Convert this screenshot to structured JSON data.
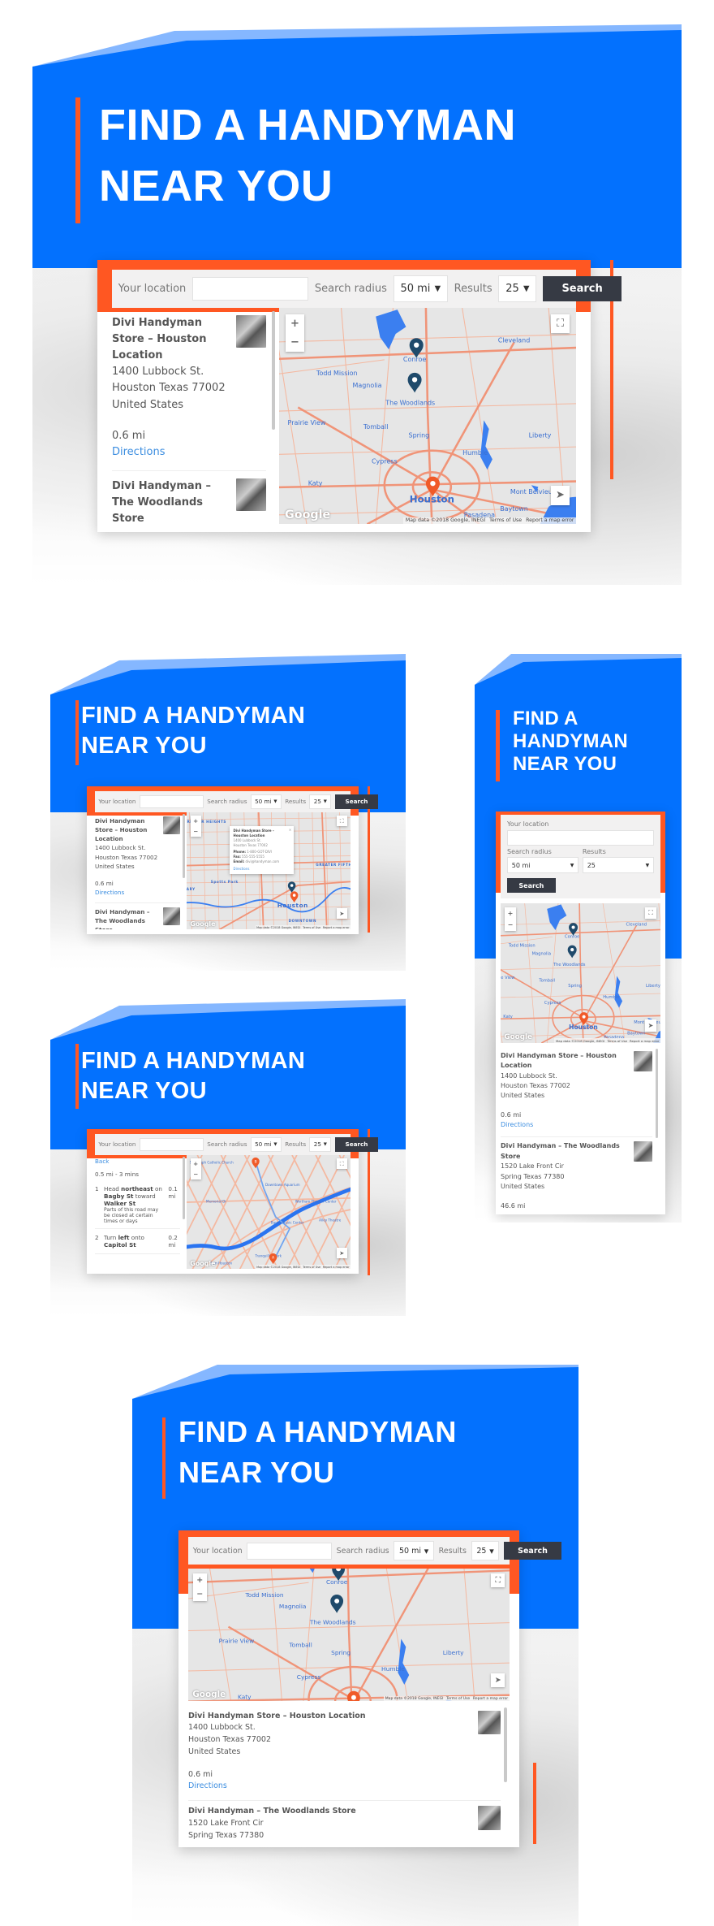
{
  "heading": "Find a Handyman Near You",
  "search_form": {
    "location_label": "Your location",
    "location_value": "",
    "radius_label": "Search radius",
    "radius_value": "50 mi",
    "results_label": "Results",
    "results_value": "25",
    "search_button": "Search"
  },
  "stores": [
    {
      "name": "Divi Handyman Store – Houston Location",
      "address": "1400 Lubbock St.",
      "city": "Houston Texas 77002",
      "country": "United States",
      "distance": "0.6 mi",
      "directions": "Directions"
    },
    {
      "name": "Divi Handyman – The Woodlands Store",
      "address": "1520 Lake Front Cir",
      "city": "Spring Texas 77380",
      "country": "United States",
      "distance": "46.6 mi",
      "directions": "Directions"
    }
  ],
  "info_window": {
    "name": "Divi Handyman Store – Houston Location",
    "address": "1400 Lubbock St.",
    "city": "Houston Texas 77002",
    "phone_label": "Phone:",
    "phone": "1-800-GOT-DIVI",
    "fax_label": "Fax:",
    "fax": "555-555-5555",
    "email_label": "Email:",
    "email": "divi@handyman.com",
    "directions": "Directions"
  },
  "directions_panel": {
    "back": "Back",
    "summary": "0.5 mi - 3 mins",
    "steps": [
      {
        "num": "1",
        "pre": "Head ",
        "b1": "northeast",
        "mid": " on ",
        "b2": "Bagby St",
        "mid2": " toward ",
        "b3": "Walker St",
        "note": "Parts of this road may be closed at certain times or days",
        "distance": "0.1 mi"
      },
      {
        "num": "2",
        "pre": "Turn ",
        "b1": "left",
        "mid": " onto ",
        "b2": "Capitol St",
        "mid2": "",
        "b3": "",
        "note": "",
        "distance": "0.2 mi"
      }
    ]
  },
  "map": {
    "region_labels": [
      "Conroe",
      "Cleveland",
      "Todd Mission",
      "Magnolia",
      "The Woodlands",
      "Tomball",
      "Spring",
      "Humble",
      "Prairie View",
      "Cypress",
      "Houston",
      "Pasadena",
      "Katy",
      "Mont Belvieu",
      "Baytown",
      "Liberty"
    ],
    "street_labels": [
      "GREATER HEIGHTS",
      "MILITARY",
      "Spotts Park",
      "Houston",
      "DOWNTOWN",
      "GREATER FIFTH WARD"
    ],
    "route_labels": [
      "St. Joseph Catholic Church",
      "Memorial Dr",
      "Downtown Aquarium",
      "Wortham Theater Center",
      "Alley Theatre",
      "Bayou Music Center",
      "Tranquillity Park",
      "Sam Houston"
    ],
    "route_pins": [
      "A",
      "B"
    ],
    "google": "Google",
    "attribution": "Map data ©2018 Google, INEGI",
    "terms": "Terms of Use",
    "report": "Report a map error",
    "zoom_in": "+",
    "zoom_out": "−"
  },
  "colors": {
    "brand_blue": "#0371fe",
    "accent_orange": "#ff5722",
    "button_dark": "#363a44",
    "link_blue": "#3b8de0",
    "pin_navy": "#1f4a6b",
    "pin_orange": "#f05a28"
  },
  "icons": [
    "zoom-in-icon",
    "zoom-out-icon",
    "fullscreen-icon",
    "my-location-icon",
    "map-pin-icon",
    "caret-down-icon",
    "close-icon"
  ]
}
